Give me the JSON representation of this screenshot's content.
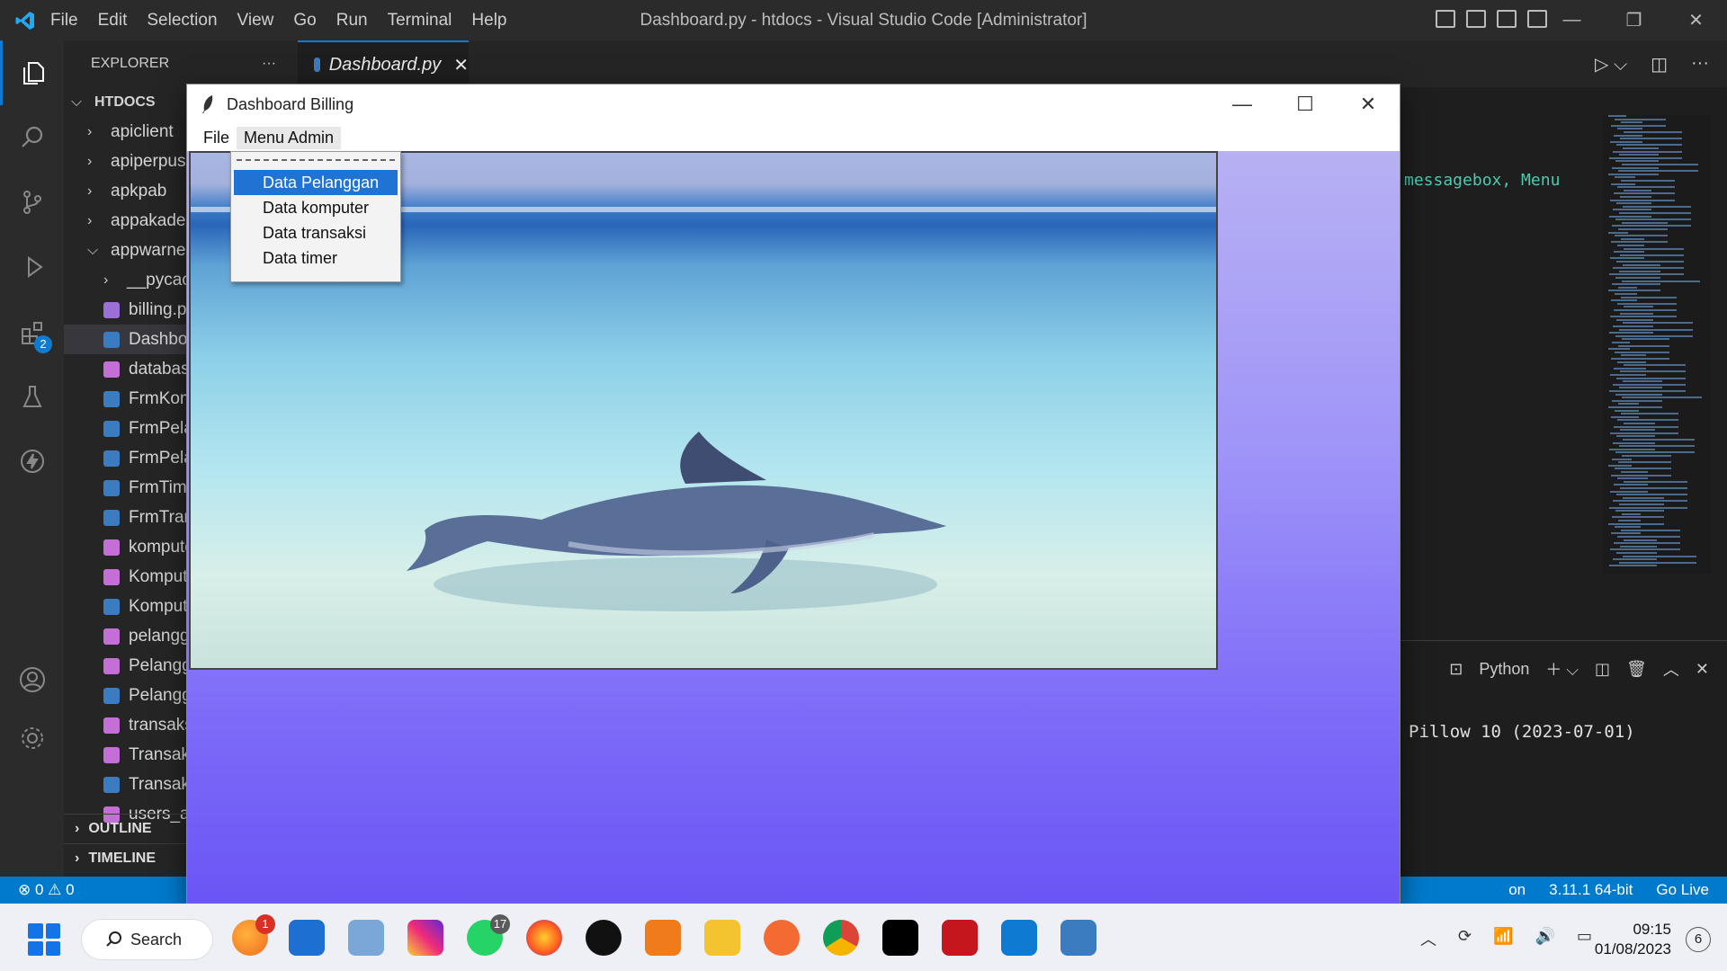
{
  "vscode": {
    "menu": [
      "File",
      "Edit",
      "Selection",
      "View",
      "Go",
      "Run",
      "Terminal",
      "Help"
    ],
    "window_title": "Dashboard.py - htdocs - Visual Studio Code [Administrator]",
    "explorer_label": "EXPLORER",
    "explorer_more": "···",
    "root_folder": "HTDOCS",
    "tree": [
      {
        "label": "apiclient",
        "kind": "folder"
      },
      {
        "label": "apiperpus",
        "kind": "folder"
      },
      {
        "label": "apkpab",
        "kind": "folder"
      },
      {
        "label": "appakade",
        "kind": "folder"
      },
      {
        "label": "appwarne",
        "kind": "folder-open"
      },
      {
        "label": "__pycach",
        "kind": "folder"
      },
      {
        "label": "billing.p",
        "kind": "image"
      },
      {
        "label": "Dashboa",
        "kind": "py"
      },
      {
        "label": "database",
        "kind": "db"
      },
      {
        "label": "FrmKom",
        "kind": "py"
      },
      {
        "label": "FrmPelar",
        "kind": "py"
      },
      {
        "label": "FrmPelar",
        "kind": "py"
      },
      {
        "label": "FrmTime",
        "kind": "py"
      },
      {
        "label": "FrmTrans",
        "kind": "py"
      },
      {
        "label": "kompute",
        "kind": "db"
      },
      {
        "label": "Kompute",
        "kind": "db"
      },
      {
        "label": "Kompute",
        "kind": "py"
      },
      {
        "label": "pelangg",
        "kind": "db"
      },
      {
        "label": "Pelangg",
        "kind": "db"
      },
      {
        "label": "Pelangg",
        "kind": "py"
      },
      {
        "label": "transaks",
        "kind": "db"
      },
      {
        "label": "Transaks",
        "kind": "db"
      },
      {
        "label": "Transaks",
        "kind": "py"
      },
      {
        "label": "users_an",
        "kind": "db"
      }
    ],
    "outline_label": "OUTLINE",
    "timeline_label": "TIMELINE",
    "tab_label": "Dashboard.py",
    "tab_close": "✕",
    "activity_badge": "2",
    "code_snippet_part1": "messagebox,",
    "code_snippet_part2": " Menu",
    "terminal_profile": "Python",
    "terminal_text": "Pillow 10 (2023-07-01)",
    "status_left": "⊗ 0 ⚠ 0",
    "status_right": [
      "on",
      "3.11.1 64-bit",
      "Go Live"
    ]
  },
  "tk_window": {
    "title": "Dashboard Billing",
    "menubar": [
      "File",
      "Menu Admin"
    ],
    "dropdown_items": [
      "Data Pelanggan",
      "Data komputer",
      "Data transaksi",
      "Data timer"
    ],
    "highlighted_index": 0
  },
  "taskbar": {
    "search_label": "Search",
    "app_badges": {
      "app1": "1",
      "whatsapp": "17"
    },
    "time": "09:15",
    "date": "01/08/2023",
    "notification_count": "6"
  },
  "colors": {
    "vscode_accent": "#007acc",
    "menu_highlight": "#1f73d2",
    "tk_background_top": "#b7b1f3",
    "tk_background_bottom": "#6a55f5"
  }
}
